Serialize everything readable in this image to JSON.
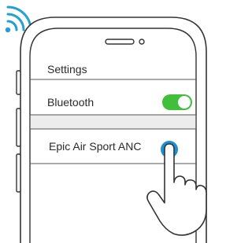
{
  "settings": {
    "title": "Settings",
    "bluetooth_label": "Bluetooth",
    "bluetooth_on": true,
    "device_name": "Epic Air Sport ANC"
  },
  "colors": {
    "wifi": "#22a0d6",
    "toggle_on": "#3fbf3a",
    "selected_dot": "#1c8fd2",
    "band": "#ececec"
  },
  "icons": [
    "wifi-signal-icon",
    "phone-speaker-icon",
    "toggle-switch-icon",
    "pointing-hand-icon"
  ]
}
